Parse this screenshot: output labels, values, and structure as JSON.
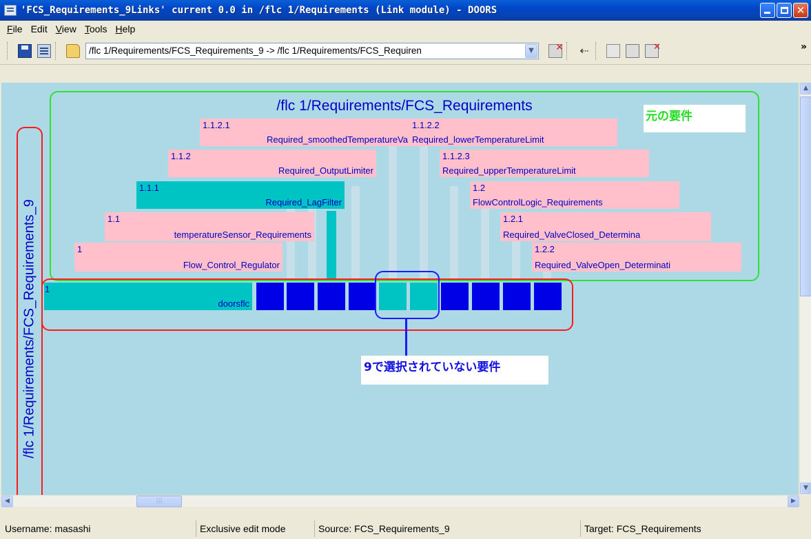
{
  "window": {
    "title": "'FCS_Requirements_9Links' current 0.0 in /flc 1/Requirements (Link module) - DOORS"
  },
  "menu": {
    "items": [
      {
        "label": "File",
        "accel": "F",
        "rest": "ile"
      },
      {
        "label": "Edit",
        "accel": "",
        "rest": "Edit"
      },
      {
        "label": "View",
        "accel": "V",
        "rest": "iew"
      },
      {
        "label": "Tools",
        "accel": "T",
        "rest": "ools"
      },
      {
        "label": "Help",
        "accel": "H",
        "rest": "elp"
      }
    ]
  },
  "toolbar": {
    "path_value": "/flc 1/Requirements/FCS_Requirements_9 -> /flc 1/Requirements/FCS_Requiren",
    "overflow": "»"
  },
  "canvas": {
    "target_module": "/flc 1/Requirements/FCS_Requirements",
    "source_module": "/flc 1/Requirements/FCS_Requirements_9",
    "target_nodes": [
      {
        "num": "1.1.2.1",
        "label": "Required_smoothedTemperatureVa",
        "state": "unlinked"
      },
      {
        "num": "1.1.2.2",
        "label": "Required_lowerTemperatureLimit",
        "state": "unlinked"
      },
      {
        "num": "1.1.2",
        "label": "Required_OutputLimiter",
        "state": "unlinked"
      },
      {
        "num": "1.1.2.3",
        "label": "Required_upperTemperatureLimit",
        "state": "unlinked"
      },
      {
        "num": "1.1.1",
        "label": "Required_LagFilter",
        "state": "linked"
      },
      {
        "num": "1.2",
        "label": "FlowControlLogic_Requirements",
        "state": "unlinked"
      },
      {
        "num": "1.1",
        "label": "temperatureSensor_Requirements",
        "state": "unlinked"
      },
      {
        "num": "1.2.1",
        "label": "Required_ValveClosed_Determina",
        "state": "unlinked"
      },
      {
        "num": "1",
        "label": "Flow_Control_Regulator",
        "state": "unlinked"
      },
      {
        "num": "1.2.2",
        "label": "Required_ValveOpen_Determinati",
        "state": "unlinked"
      }
    ],
    "source_root": {
      "num": "1",
      "label": "doorsflc"
    },
    "source_cells": [
      "selected",
      "selected",
      "selected",
      "selected",
      "unselected",
      "unselected",
      "selected",
      "selected",
      "selected",
      "selected"
    ],
    "annotation_original": "元の要件",
    "annotation_unselected": "9で選択されていない要件",
    "colors": {
      "background": "#add8e6",
      "unlinked": "#ffc0cb",
      "linked": "#00c4c4",
      "selected_cell": "#0000e6",
      "frame_target": "#2ee22e",
      "frame_source": "#ff1a1a",
      "frame_highlight": "#1a1aff",
      "label_text": "#0000c0"
    }
  },
  "status": {
    "username": "Username: masashi",
    "mode": "Exclusive edit mode",
    "source": "Source: FCS_Requirements_9",
    "target": "Target: FCS_Requirements"
  }
}
